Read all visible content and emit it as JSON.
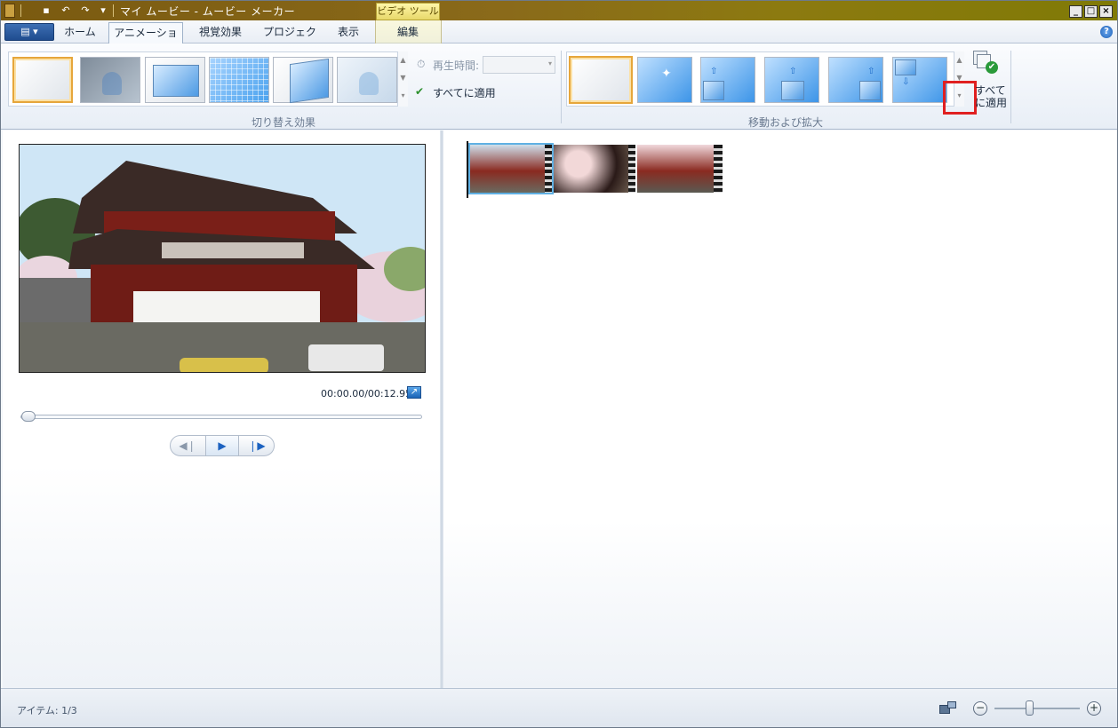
{
  "titlebar": {
    "title": "マイ ムービー - ムービー メーカー",
    "context_tab_header": "ビデオ ツール",
    "minimize": "_",
    "maximize": "□",
    "close": "×"
  },
  "tabs": {
    "file_label": "▤ ▾",
    "items": [
      {
        "label": "ホーム"
      },
      {
        "label": "アニメーション"
      },
      {
        "label": "視覚効果"
      },
      {
        "label": "プロジェクト"
      },
      {
        "label": "表示"
      },
      {
        "label": "編集"
      }
    ],
    "help": "?"
  },
  "ribbon": {
    "transitions": {
      "group_label": "切り替え効果",
      "duration_label": "再生時間:",
      "apply_all_label": "すべてに適用"
    },
    "pan_zoom": {
      "group_label": "移動および拡大",
      "apply_all_line1": "すべて",
      "apply_all_line2": "に適用"
    }
  },
  "preview": {
    "time": "00:00.00/00:12.95",
    "playback_fraction": 0
  },
  "statusbar": {
    "items_text": "アイテム: 1/3",
    "zoom_minus": "−",
    "zoom_plus": "+"
  },
  "colors": {
    "titlebar": "#8a6a1a",
    "selection_gold": "#e6a63a",
    "highlight_red": "#e02020",
    "accent_blue": "#1c62c0"
  }
}
